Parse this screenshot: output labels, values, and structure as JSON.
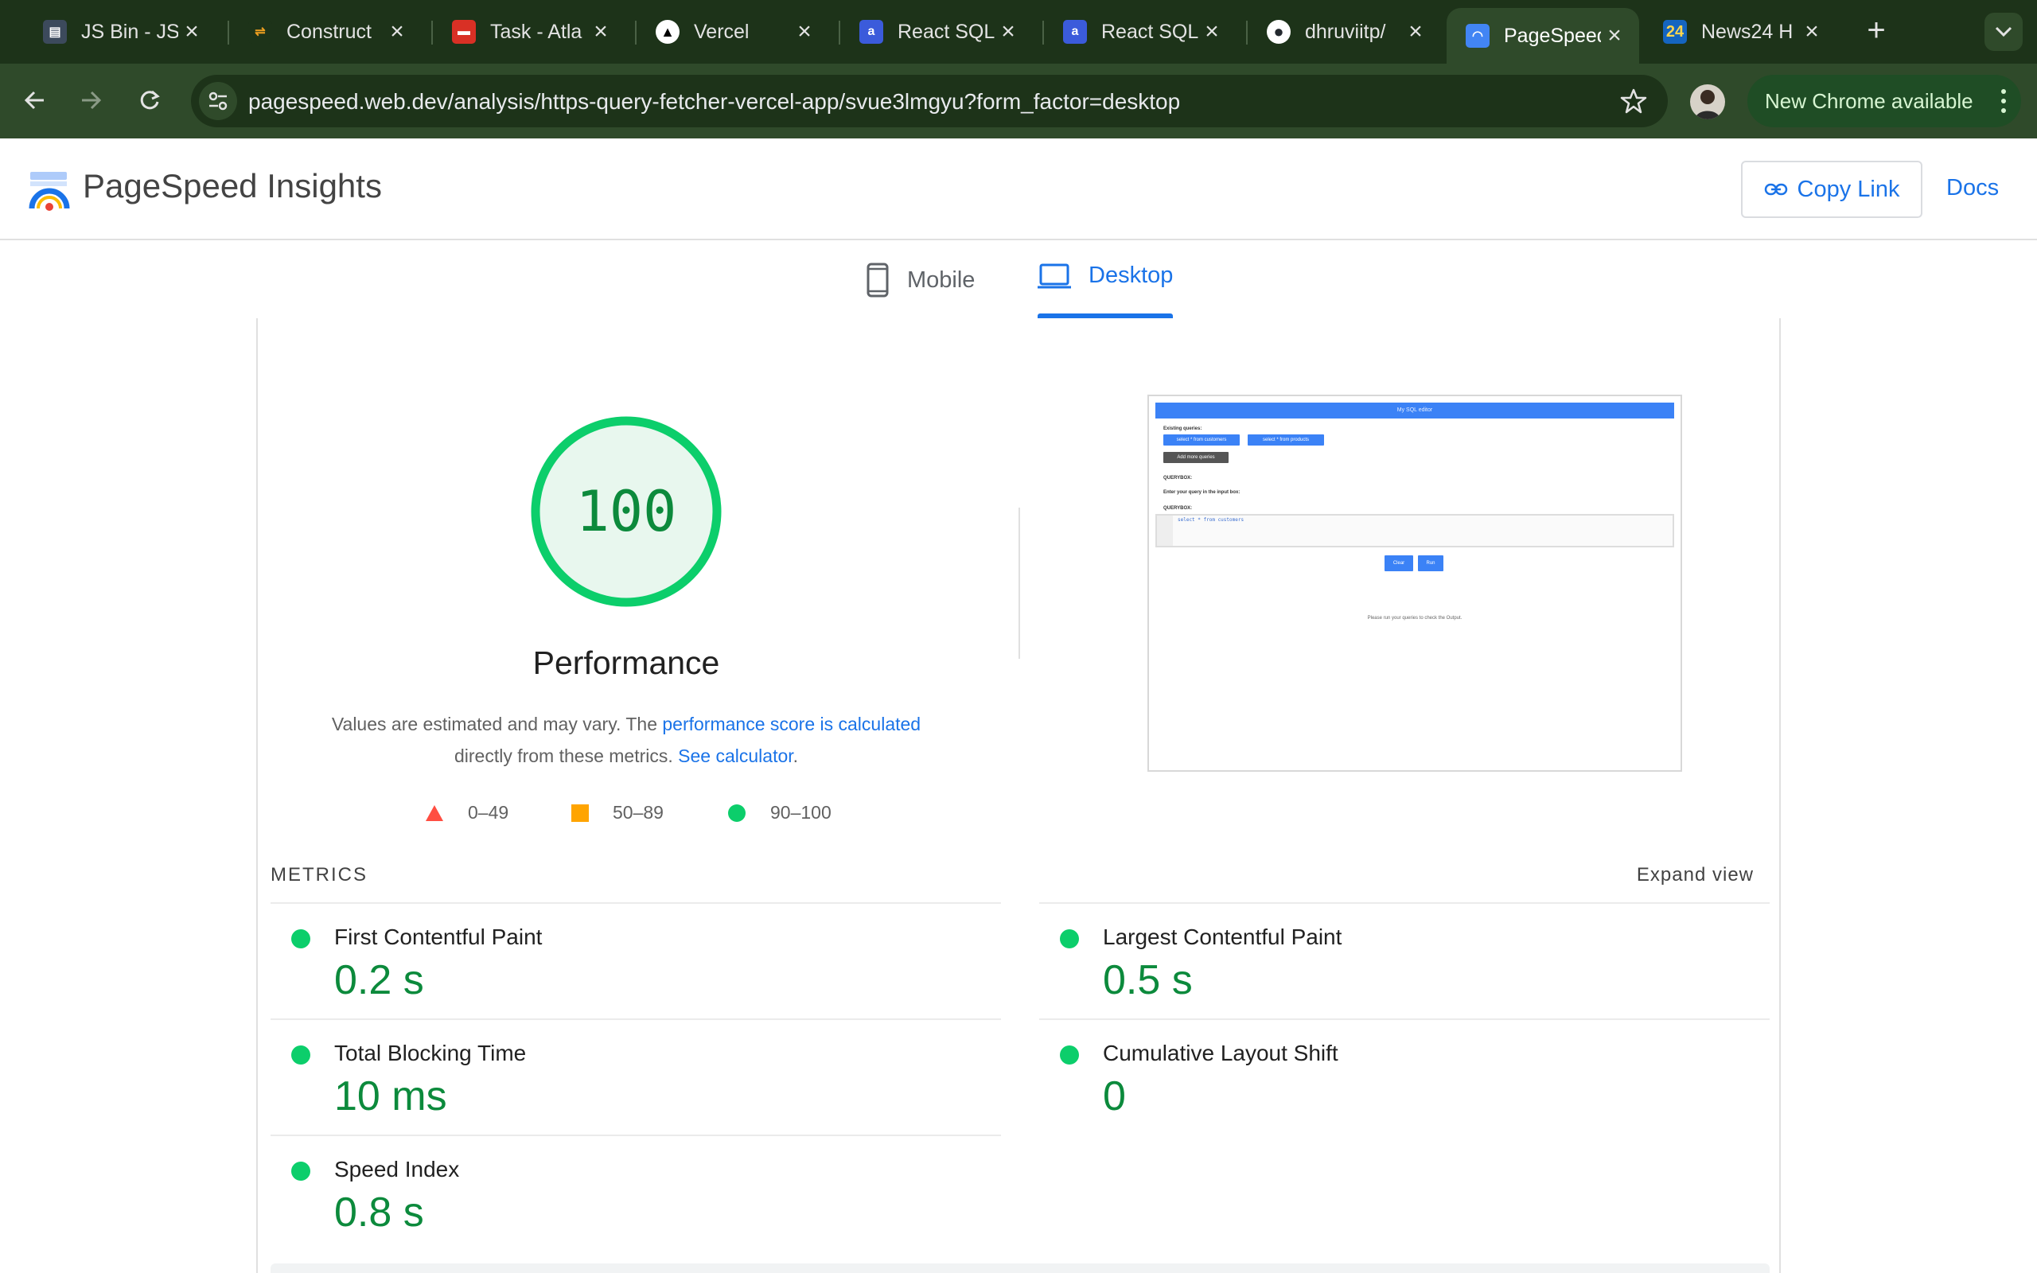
{
  "browser": {
    "tabs": [
      {
        "title": "JS Bin - JS",
        "favicon": "jsbin-icon",
        "color": "#3c4a5c",
        "glyph": "▤"
      },
      {
        "title": "Construct",
        "favicon": "construct-icon",
        "color": "#1d3319",
        "glyph": "⇌"
      },
      {
        "title": "Task - Atla",
        "favicon": "atlas-icon",
        "color": "#d93025",
        "glyph": "▬"
      },
      {
        "title": "Vercel",
        "favicon": "vercel-icon",
        "color": "#000000",
        "glyph": "▲"
      },
      {
        "title": "React SQL",
        "favicon": "react-sql-icon",
        "color": "#3b5bdb",
        "glyph": "a"
      },
      {
        "title": "React SQL",
        "favicon": "react-sql-icon",
        "color": "#3b5bdb",
        "glyph": "a"
      },
      {
        "title": "dhruviitp/",
        "favicon": "github-icon",
        "color": "#24292f",
        "glyph": "●"
      },
      {
        "title": "PageSpeed",
        "favicon": "pagespeed-icon",
        "color": "#4285f4",
        "glyph": "◠",
        "active": true
      },
      {
        "title": "News24 H",
        "favicon": "news24-icon",
        "color": "#1565c0",
        "glyph": "24"
      }
    ],
    "url": "pagespeed.web.dev/analysis/https-query-fetcher-vercel-app/svue3lmgyu?form_factor=desktop",
    "update_label": "New Chrome available"
  },
  "header": {
    "title": "PageSpeed Insights",
    "copy_link": "Copy Link",
    "docs": "Docs"
  },
  "form_factor": {
    "mobile": "Mobile",
    "desktop": "Desktop",
    "selected": "Desktop"
  },
  "performance": {
    "score": "100",
    "score_fraction": 1.0,
    "title": "Performance",
    "desc_prefix": "Values are estimated and may vary. The ",
    "desc_link": "performance score is calculated",
    "desc_middle": "directly from these metrics. ",
    "desc_link2": "See calculator",
    "desc_suffix": ".",
    "legend": [
      {
        "range": "0–49",
        "shape": "triangle",
        "color": "#ff4e42"
      },
      {
        "range": "50–89",
        "shape": "square",
        "color": "#ffa400"
      },
      {
        "range": "90–100",
        "shape": "circle",
        "color": "#0cce6b"
      }
    ],
    "colors": {
      "pass": "#0cce6b",
      "pass_text": "#0c8a3c",
      "pass_fill": "#e8f7ee"
    }
  },
  "thumbnail": {
    "title": "My SQL editor",
    "existing_queries": "Existing queries:",
    "query1": "select * from customers",
    "query2": "select * from products",
    "add_more": "Add more queries",
    "querybox_label": "QUERYBOX:",
    "enter_query": "Enter your query in the input box:",
    "querybox_label2": "QUERYBOX:",
    "code": "select * from customers",
    "clear": "Clear",
    "run": "Run",
    "output_hint": "Please run your queries to check the Output."
  },
  "metrics": {
    "label": "METRICS",
    "expand": "Expand view",
    "items": [
      {
        "name": "First Contentful Paint",
        "value": "0.2 s"
      },
      {
        "name": "Largest Contentful Paint",
        "value": "0.5 s"
      },
      {
        "name": "Total Blocking Time",
        "value": "10 ms"
      },
      {
        "name": "Cumulative Layout Shift",
        "value": "0"
      },
      {
        "name": "Speed Index",
        "value": "0.8 s"
      }
    ]
  }
}
